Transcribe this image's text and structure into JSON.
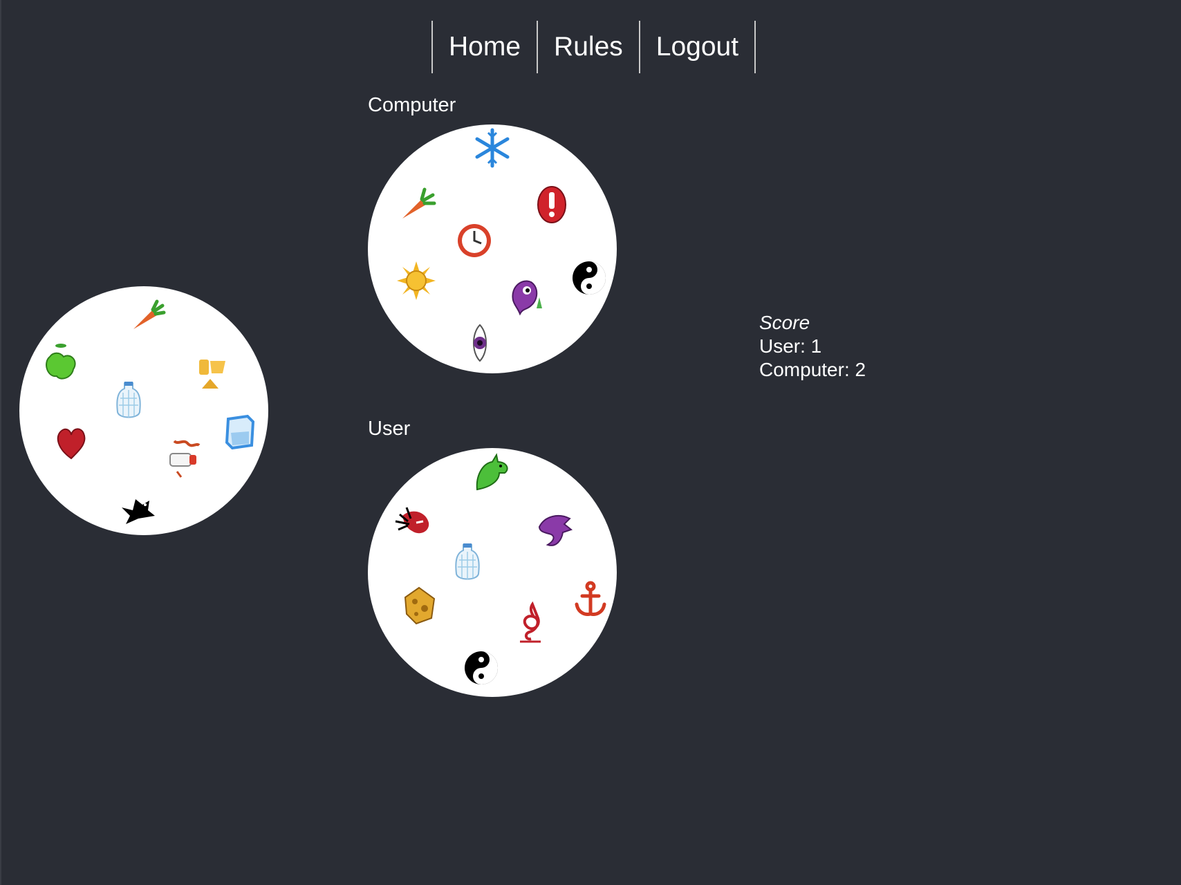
{
  "nav": {
    "home": "Home",
    "rules": "Rules",
    "logout": "Logout"
  },
  "boards": {
    "computer_label": "Computer",
    "user_label": "User"
  },
  "score": {
    "title": "Score",
    "user_line": "User: 1",
    "computer_line": "Computer: 2"
  },
  "cards": {
    "deck": [
      "carrot",
      "green-blob",
      "cheese-slices",
      "water-bottle",
      "heart",
      "baby-bottle",
      "ice-cube",
      "bird"
    ],
    "computer": [
      "snowflake",
      "carrot",
      "exclamation",
      "clock",
      "sun",
      "yin-yang",
      "ghost",
      "eye"
    ],
    "user": [
      "dinosaur",
      "spider-leaf",
      "dragon",
      "water-bottle",
      "cheese-block",
      "anchor",
      "treble-clef",
      "yin-yang"
    ]
  },
  "colors": {
    "background": "#2a2d35",
    "card": "#ffffff",
    "text": "#ffffff",
    "nav_divider": "#c9c9c9"
  }
}
